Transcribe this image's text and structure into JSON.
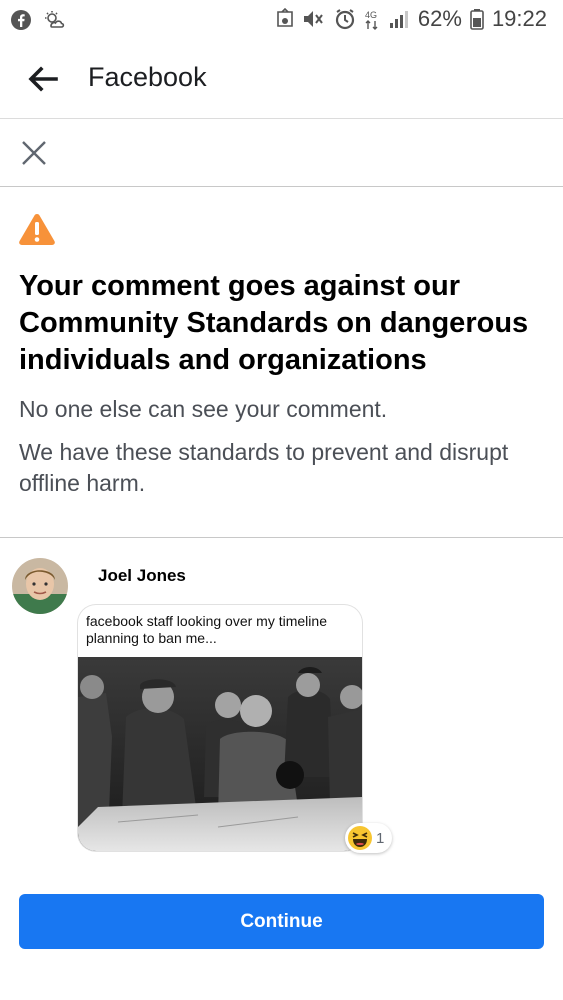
{
  "status_bar": {
    "battery_percent": "62%",
    "time": "19:22",
    "network_label": "4G",
    "icons": [
      "facebook-icon",
      "weather-icon",
      "alarm-icon",
      "mute-icon",
      "clock-icon",
      "network-4g-icon",
      "signal-icon",
      "battery-icon"
    ]
  },
  "header": {
    "title": "Facebook",
    "back_icon": "arrow-left-icon"
  },
  "dialog": {
    "close_icon": "close-icon",
    "warning_icon": "warning-triangle-icon",
    "warning_color": "#f7923a",
    "title": "Your comment goes against our Community Standards on dangerous individuals and organizations",
    "subtitle": "No one else can see your comment.",
    "explanation": "We have these standards to prevent and disrupt offline harm."
  },
  "comment": {
    "author": "Joel Jones",
    "meme_caption": "facebook staff looking over my timeline planning to ban me...",
    "reaction": {
      "icon": "laughing-emoji-icon",
      "count": "1"
    }
  },
  "actions": {
    "continue_label": "Continue",
    "continue_color": "#1877f2"
  }
}
